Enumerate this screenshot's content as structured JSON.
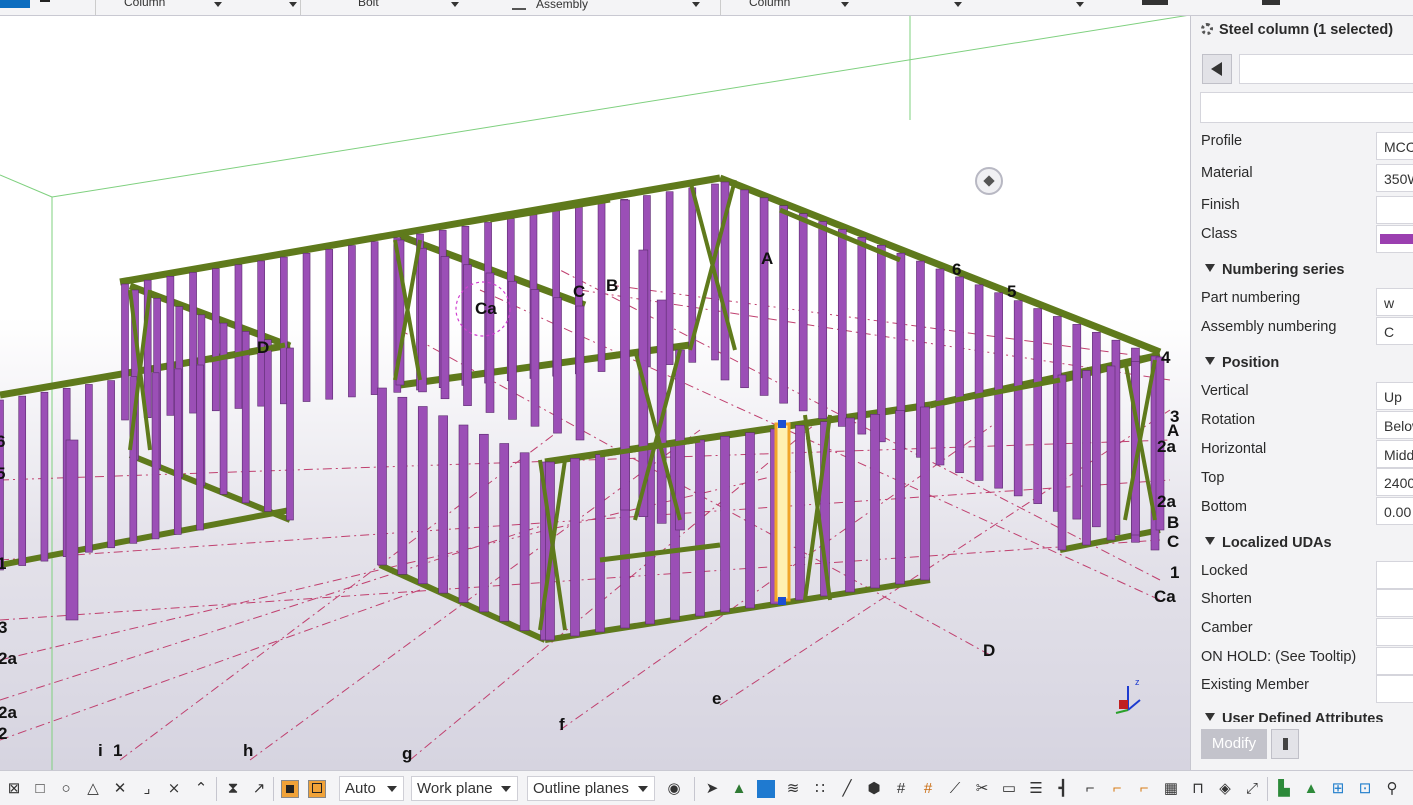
{
  "toolbar": {
    "dropdowns": [
      {
        "label": "Column"
      },
      {
        "label": ""
      },
      {
        "label": "Bolt"
      },
      {
        "label": "Assembly"
      },
      {
        "label": "Column"
      },
      {
        "label": ""
      },
      {
        "label": ""
      }
    ]
  },
  "viewport": {
    "grid_labels": [
      "A",
      "B",
      "C",
      "Ca",
      "D",
      "6",
      "5",
      "4",
      "3",
      "A",
      "2a",
      "2a",
      "B",
      "C",
      "1",
      "Ca",
      "D",
      "e",
      "f",
      "g",
      "h",
      "i",
      "1",
      "3",
      "2a",
      "2a",
      "2",
      "6",
      "5",
      "1",
      "4"
    ],
    "selected_member_color": "#f0a52a",
    "member_color": "#9b4fb6",
    "brace_color": "#5f7a1c"
  },
  "properties": {
    "title": "Steel column (1 selected)",
    "fields": [
      {
        "label": "Profile",
        "value": "MCC"
      },
      {
        "label": "Material",
        "value": "350W"
      },
      {
        "label": "Finish",
        "value": ""
      },
      {
        "label": "Class",
        "value": ""
      }
    ],
    "class_color": "#9b3fb0",
    "sections": {
      "numbering": "Numbering series",
      "position": "Position",
      "localized": "Localized UDAs",
      "user_defined": "User Defined Attributes"
    },
    "numbering": [
      {
        "label": "Part numbering",
        "value": "w"
      },
      {
        "label": "Assembly numbering",
        "value": "C"
      }
    ],
    "position": [
      {
        "label": "Vertical",
        "value": "Up"
      },
      {
        "label": "Rotation",
        "value": "Below"
      },
      {
        "label": "Horizontal",
        "value": "Middle"
      },
      {
        "label": "Top",
        "value": "2400"
      },
      {
        "label": "Bottom",
        "value": "0.00"
      }
    ],
    "localized": [
      {
        "label": "Locked",
        "value": ""
      },
      {
        "label": "Shorten",
        "value": ""
      },
      {
        "label": "Camber",
        "value": ""
      },
      {
        "label": "ON HOLD: (See Tooltip)",
        "value": ""
      },
      {
        "label": "Existing Member",
        "value": ""
      }
    ],
    "modify_label": "Modify"
  },
  "bottom": {
    "auto": "Auto",
    "workplane": "Work plane",
    "outline": "Outline planes"
  }
}
